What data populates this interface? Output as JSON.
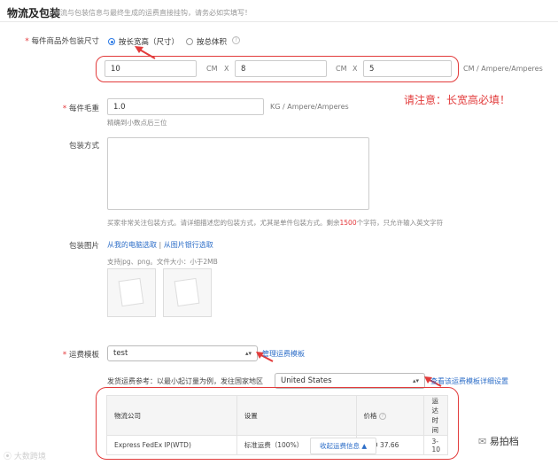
{
  "section": {
    "title": "物流及包装",
    "subtitle": "物流与包装信息与最终生成的运费直接挂钩，请务必如实填写！"
  },
  "package_size": {
    "label": "每件商品外包装尺寸",
    "required_mark": "*",
    "option_dimensions": "按长宽高（尺寸）",
    "option_volume": "按总体积",
    "help_icon": "question-circle-icon",
    "length": "10",
    "width": "8",
    "height": "5",
    "unit": "CM",
    "separator": "X",
    "unit_suffix": "CM  /  Ampere/Amperes"
  },
  "annotation": {
    "note": "请注意：长宽高必填！"
  },
  "gross_weight": {
    "label": "每件毛重",
    "required_mark": "*",
    "value": "1.0",
    "unit": "KG  /  Ampere/Amperes",
    "hint": "精确到小数点后三位"
  },
  "packing_method": {
    "label": "包装方式",
    "value": "",
    "hint_before": "买家非常关注包装方式。请详细描述您的包装方式，尤其是单件包装方式。剩余",
    "hint_count": "1500",
    "hint_after": "个字符，只允许输入英文字符"
  },
  "package_image": {
    "label": "包装图片",
    "link_local": "从我的电脑选取",
    "link_sep": "|",
    "link_bank": "从图片银行选取",
    "hint": "支持jpg、png。文件大小：小于2MB"
  },
  "shipping_template": {
    "label": "运费模板",
    "required_mark": "*",
    "selected": "test",
    "manage_link": "管理运费模板"
  },
  "shipping_reference": {
    "label": "发货运费参考：以最小起订量为例，发往国家地区",
    "country": "United States",
    "detail_link": "查看该运费模板详细设置"
  },
  "shipping_table": {
    "headers": [
      "物流公司",
      "设置",
      "价格",
      "运达时间"
    ],
    "rows": [
      [
        "Express FedEx IP(WTD)",
        "标准运费（100%）",
        "USD 37.66",
        "3-10"
      ]
    ],
    "collapse_label": "收起运费信息 ▲"
  },
  "watermarks": {
    "left": "大数跨境",
    "right": "易拍档"
  },
  "colors": {
    "accent_blue": "#2d6ec8",
    "annotation_red": "#e23b3b",
    "required_red": "#e4393c"
  }
}
